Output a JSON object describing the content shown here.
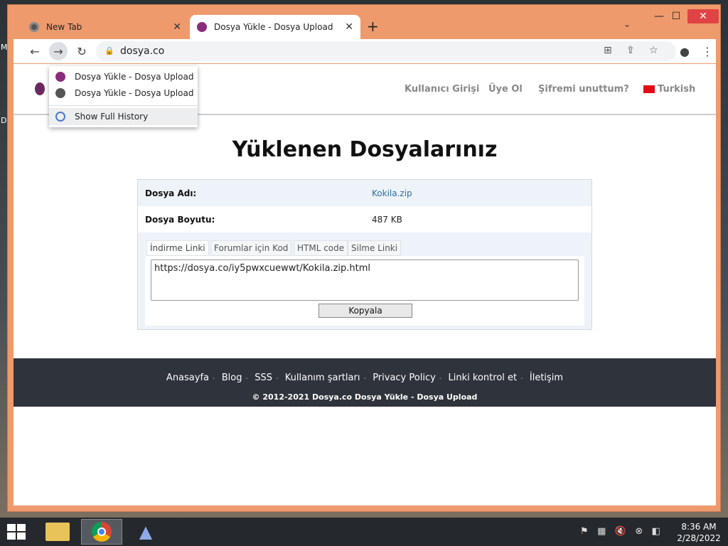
{
  "browser": {
    "tabs": [
      {
        "title": "New Tab",
        "icon": "chrome-icon"
      },
      {
        "title": "Dosya Yükle - Dosya Upload",
        "icon": "dosya-favicon",
        "active": true
      }
    ],
    "url": "dosya.co",
    "history_menu": {
      "items": [
        "Dosya Yükle - Dosya Upload",
        "Dosya Yükle - Dosya Upload"
      ],
      "show_full": "Show Full History"
    }
  },
  "site": {
    "nav": {
      "login": "Kullanıcı Girişi",
      "signup": "Üye Ol",
      "forgot": "Şifremi unuttum?",
      "language": "Turkish"
    },
    "heading": "Yüklenen Dosyalarınız",
    "file": {
      "name_label": "Dosya Adı:",
      "name": "Kokila.zip",
      "size_label": "Dosya Boyutu:",
      "size": "487 KB"
    },
    "link_tabs": [
      "İndirme Linki",
      "Forumlar için Kod",
      "HTML code",
      "Silme Linki"
    ],
    "link_value": "https://dosya.co/iy5pwxcuewwt/Kokila.zip.html",
    "copy_button": "Kopyala",
    "footer": {
      "links": [
        "Anasayfa",
        "Blog",
        "SSS",
        "Kullanım şartları",
        "Privacy Policy",
        "Linki kontrol et",
        "İletişim"
      ],
      "copyright": "© 2012-2021 Dosya.co Dosya Yükle - Dosya Upload"
    }
  },
  "taskbar": {
    "time": "8:36 AM",
    "date": "2/28/2022"
  },
  "colors": {
    "window_frame": "#ee9a6d",
    "link": "#2a6fa8",
    "footer_bg": "#2f333b",
    "close": "#e04343"
  }
}
